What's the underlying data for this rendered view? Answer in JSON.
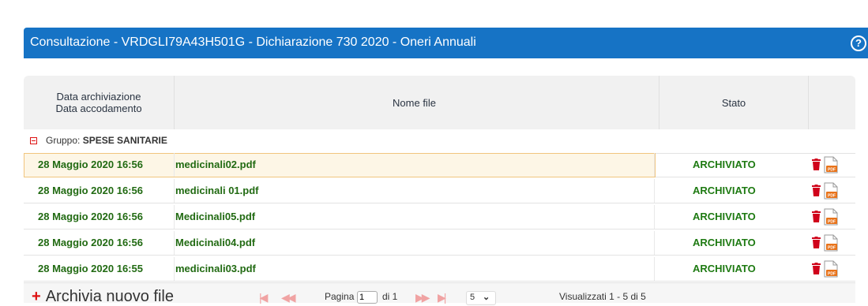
{
  "header": {
    "title": "Consultazione - VRDGLI79A43H501G - Dichiarazione 730 2020 - Oneri Annuali",
    "help_icon": "?"
  },
  "table": {
    "columns": [
      {
        "line1": "Data archiviazione",
        "line2": "Data accodamento"
      },
      {
        "line1": "Nome file",
        "line2": ""
      },
      {
        "line1": "Stato",
        "line2": ""
      },
      {
        "line1": "",
        "line2": ""
      }
    ],
    "group": {
      "prefix": "Gruppo:",
      "name": "SPESE SANITARIE"
    },
    "rows": [
      {
        "date": "28 Maggio 2020 16:56",
        "file": "medicinali02.pdf",
        "stato": "ARCHIVIATO",
        "selected": true
      },
      {
        "date": "28 Maggio 2020 16:56",
        "file": "medicinali 01.pdf",
        "stato": "ARCHIVIATO",
        "selected": false
      },
      {
        "date": "28 Maggio 2020 16:56",
        "file": "Medicinali05.pdf",
        "stato": "ARCHIVIATO",
        "selected": false
      },
      {
        "date": "28 Maggio 2020 16:56",
        "file": "Medicinali04.pdf",
        "stato": "ARCHIVIATO",
        "selected": false
      },
      {
        "date": "28 Maggio 2020 16:55",
        "file": "medicinali03.pdf",
        "stato": "ARCHIVIATO",
        "selected": false
      }
    ]
  },
  "footer": {
    "add_label": "Archivia nuovo file",
    "page_label": "Pagina",
    "page_value": "1",
    "of_label": "di 1",
    "page_size": "5",
    "viewed": "Visualizzati 1 - 5 di 5"
  },
  "colors": {
    "header_bg": "#1673c5",
    "status_green": "#1e7a12",
    "delete_red": "#d0021b",
    "pdf_orange": "#e8731a"
  },
  "icons": {
    "help": "help-icon",
    "delete": "trash-icon",
    "pdf": "pdf-file-icon",
    "first": "first-page-icon",
    "prev": "prev-page-icon",
    "next": "next-page-icon",
    "last": "last-page-icon"
  }
}
